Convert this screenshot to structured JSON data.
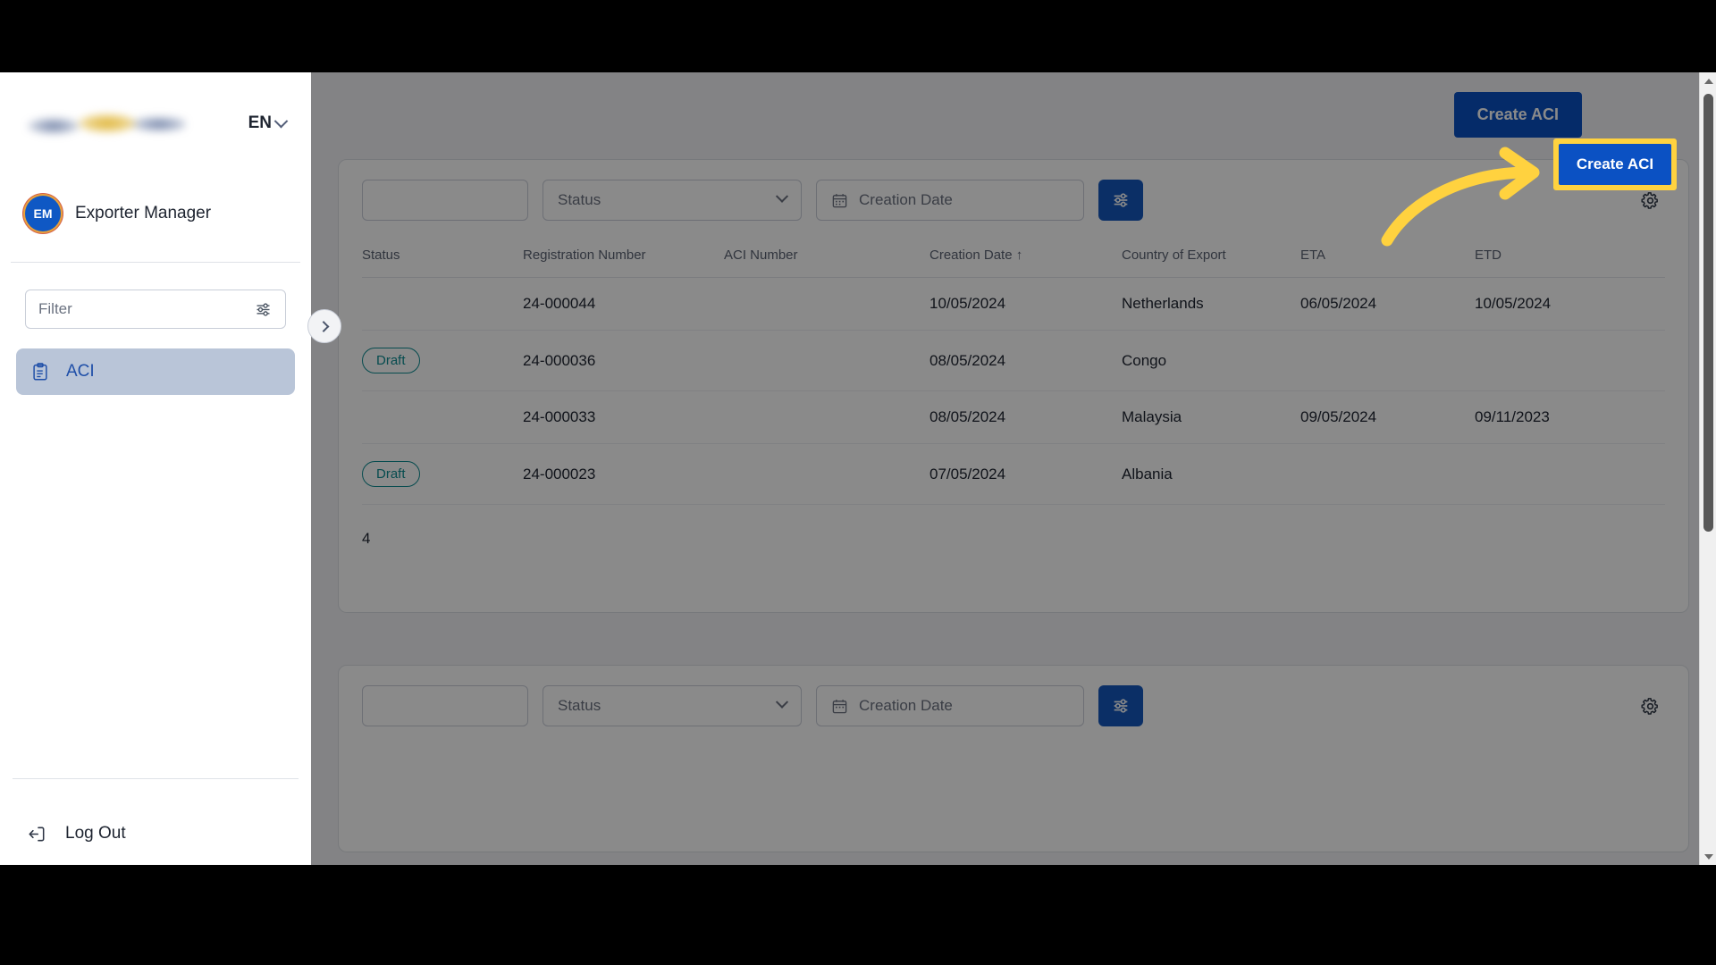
{
  "sidebar": {
    "logo_alt": "company-logo-blurred",
    "language": {
      "label": "EN"
    },
    "user": {
      "initials": "EM",
      "name": "Exporter Manager"
    },
    "filter": {
      "placeholder": "Filter",
      "value": ""
    },
    "nav_items": [
      {
        "label": "ACI",
        "icon": "clipboard-icon",
        "active": true
      }
    ],
    "logout": {
      "label": "Log Out",
      "icon": "logout-icon"
    },
    "collapse_toggle": {
      "icon": "chevron-right-icon"
    }
  },
  "topbar": {
    "create_button": "Create ACI"
  },
  "highlight": {
    "button_label": "Create ACI",
    "ring_color": "#ffd23f",
    "arrow_color": "#ffd23f"
  },
  "panel_primary": {
    "filters": {
      "search_placeholder": "",
      "status_placeholder": "Status",
      "status_value": "",
      "date_placeholder": "Creation Date",
      "date_value": "",
      "apply_icon": "sliders-icon",
      "settings_icon": "gear-icon",
      "calendar_icon": "calendar-icon"
    },
    "table": {
      "columns": [
        "Status",
        "Registration Number",
        "ACI Number",
        "Creation Date ↑",
        "Country of Export",
        "ETA",
        "ETD"
      ],
      "sort_column": "Creation Date",
      "sort_direction": "asc",
      "rows": [
        {
          "status": "",
          "status_style": "none",
          "registration_number": "24-000044",
          "aci_number": "",
          "creation_date": "10/05/2024",
          "country_of_export": "Netherlands",
          "eta": "06/05/2024",
          "etd": "10/05/2024"
        },
        {
          "status": "Draft",
          "status_style": "teal",
          "registration_number": "24-000036",
          "aci_number": "",
          "creation_date": "08/05/2024",
          "country_of_export": "Congo",
          "eta": "",
          "etd": ""
        },
        {
          "status": "",
          "status_style": "none",
          "registration_number": "24-000033",
          "aci_number": "",
          "creation_date": "08/05/2024",
          "country_of_export": "Malaysia",
          "eta": "09/05/2024",
          "etd": "09/11/2023"
        },
        {
          "status": "Draft",
          "status_style": "teal",
          "registration_number": "24-000023",
          "aci_number": "",
          "creation_date": "07/05/2024",
          "country_of_export": "Albania",
          "eta": "",
          "etd": ""
        }
      ],
      "footer_count": "4"
    }
  },
  "panel_secondary": {
    "filters": {
      "search_placeholder": "",
      "status_placeholder": "Status",
      "date_placeholder": "Creation Date",
      "apply_icon": "sliders-icon",
      "settings_icon": "gear-icon",
      "calendar_icon": "calendar-icon"
    }
  },
  "scrollbar": {
    "up_icon": "triangle-up-icon",
    "down_icon": "triangle-down-icon"
  }
}
